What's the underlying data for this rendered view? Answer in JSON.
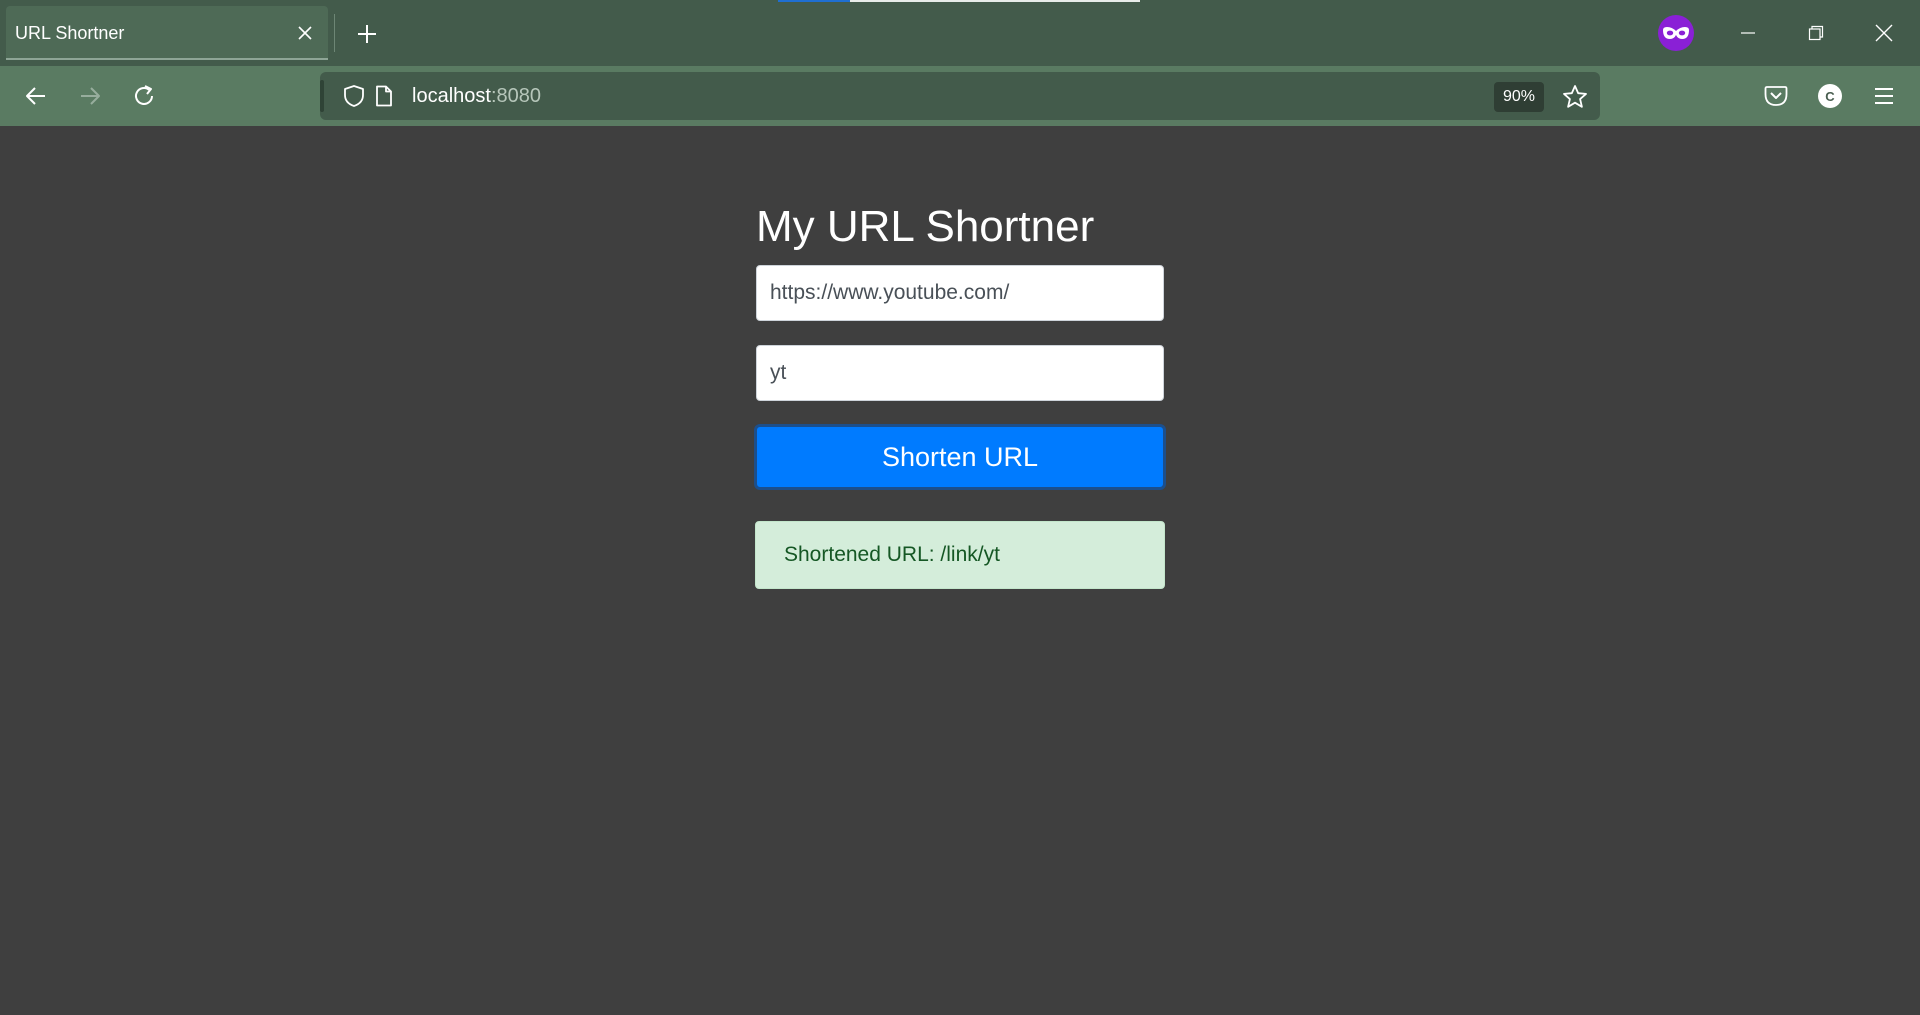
{
  "browser": {
    "tab": {
      "title": "URL Shortner"
    },
    "address_bar": {
      "host": "localhost",
      "port": ":8080"
    },
    "zoom": "90%",
    "account_initial": "C"
  },
  "page": {
    "title": "My URL Shortner",
    "url_input": {
      "value": "https://www.youtube.com/"
    },
    "alias_input": {
      "value": "yt"
    },
    "submit_label": "Shorten URL",
    "result_text": "Shortened URL: /link/yt"
  },
  "colors": {
    "tabstrip": "#435b4b",
    "toolbar": "#5a7b62",
    "page_background": "#3f3f3f",
    "primary_button": "#007bff",
    "success_background": "#d4edda",
    "success_text": "#155724",
    "private_browsing": "#8a20d6"
  },
  "icons": {
    "tab_close": "close-icon",
    "new_tab": "plus-icon",
    "private": "private-browsing-mask-icon",
    "minimize": "minimize-icon",
    "restore": "restore-icon",
    "close_window": "close-icon",
    "back": "arrow-left-icon",
    "forward": "arrow-right-icon",
    "reload": "reload-icon",
    "tracking_protection": "shield-icon",
    "page_info": "page-icon",
    "bookmark": "star-icon",
    "pocket": "pocket-icon",
    "menu": "hamburger-icon"
  }
}
